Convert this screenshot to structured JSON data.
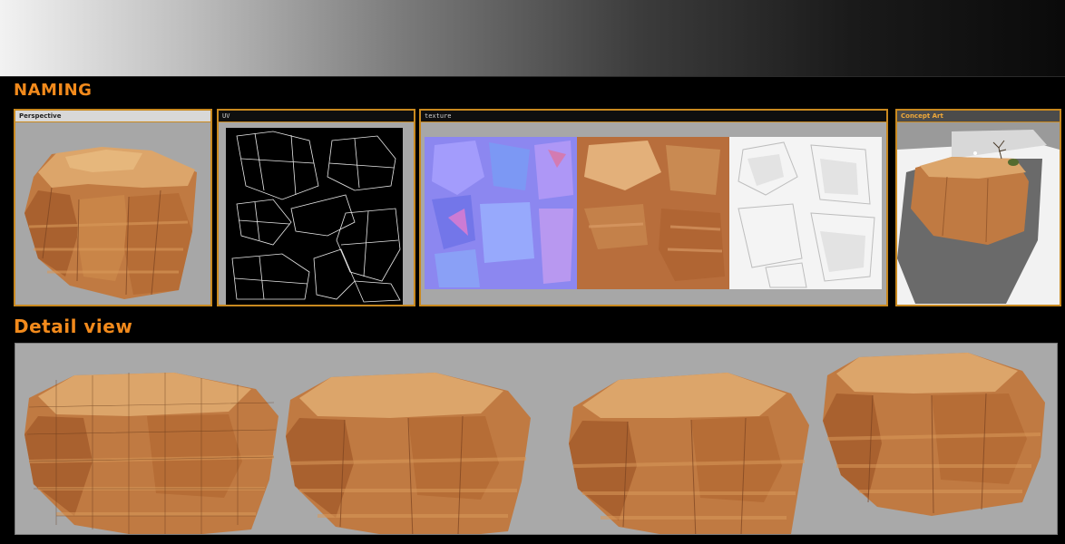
{
  "sections": {
    "naming_title": "NAMING",
    "detail_title": "Detail view"
  },
  "panels": {
    "perspective_label": "Perspective",
    "uv_label": "UV",
    "texture_label": "texture",
    "concept_label": "Concept Art"
  },
  "colors": {
    "accent_orange": "#f28a1c",
    "panel_border": "#c9891f",
    "viewport_grey": "#a7a7a7",
    "rock_light": "#d9a066",
    "rock_mid": "#c07a42",
    "rock_dark": "#8a4f26",
    "normal_map": "#8c87f0",
    "ao_map": "#f2f2f2"
  },
  "icons": {
    "rock_model": "rock-cliff-icon",
    "uv_wireframe": "uv-wireframe-icon"
  }
}
